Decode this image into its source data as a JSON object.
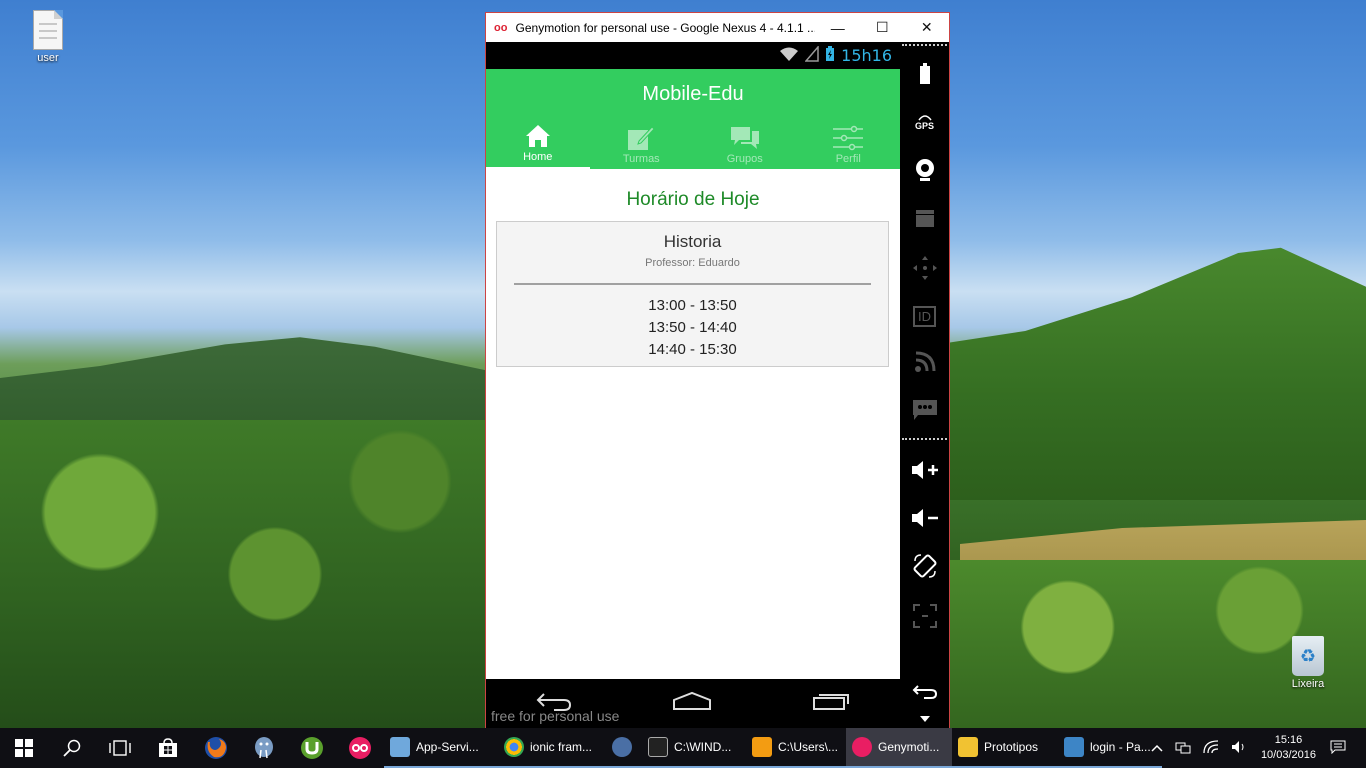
{
  "desktop": {
    "icons": [
      {
        "label": "user",
        "icon": "text-file-icon"
      },
      {
        "label": "Lixeira",
        "icon": "recycle-bin-icon"
      }
    ]
  },
  "window": {
    "title": "Genymotion for personal use - Google Nexus 4 - 4.1.1 ...",
    "controls": {
      "minimize": "—",
      "maximize": "☐",
      "close": "✕"
    }
  },
  "device": {
    "status": {
      "time": "15h16",
      "wifi": "wifi-icon",
      "signal": "signal-icon",
      "battery": "battery-charging-icon"
    },
    "app": {
      "title": "Mobile-Edu",
      "tabs": [
        {
          "label": "Home",
          "icon": "home-icon",
          "active": true
        },
        {
          "label": "Turmas",
          "icon": "edit-icon",
          "active": false
        },
        {
          "label": "Grupos",
          "icon": "chat-icon",
          "active": false
        },
        {
          "label": "Perfil",
          "icon": "sliders-icon",
          "active": false
        }
      ],
      "heading": "Horário de Hoje",
      "schedule": {
        "subject": "Historia",
        "teacher": "Professor: Eduardo",
        "times": [
          "13:00 - 13:50",
          "13:50 - 14:40",
          "14:40 - 15:30"
        ]
      }
    },
    "navbar": [
      "back-icon",
      "home-icon",
      "recent-apps-icon"
    ],
    "watermark": "free for personal use"
  },
  "sidebar": [
    "battery-icon",
    "gps-icon",
    "webcam-icon",
    "camera-icon",
    "dpad-icon",
    "id-icon",
    "rss-icon",
    "sms-icon",
    "volume-up-icon",
    "volume-down-icon",
    "rotate-icon",
    "scale-icon",
    "back-icon",
    "scroll-down-icon"
  ],
  "sidebar_labels": {
    "gps": "GPS",
    "id": "ID"
  },
  "taskbar": {
    "pinned": [
      "start-icon",
      "search-icon",
      "task-view-icon",
      "store-icon",
      "firefox-icon",
      "postgres-icon",
      "utorrent-icon",
      "genymotion-icon"
    ],
    "apps": [
      {
        "label": "App-Servi...",
        "color": "#6fa8dc"
      },
      {
        "label": "ionic fram...",
        "color": "#e8453c"
      },
      {
        "label": "",
        "color": "#4a6fa5"
      },
      {
        "label": "C:\\WIND...",
        "color": "#222222"
      },
      {
        "label": "C:\\Users\\...",
        "color": "#f39c12"
      },
      {
        "label": "Genymoti...",
        "color": "#e91e63",
        "active": true
      },
      {
        "label": "Prototipos",
        "color": "#f1c232"
      },
      {
        "label": "login - Pa...",
        "color": "#3d85c6"
      }
    ],
    "clock": {
      "time": "15:16",
      "date": "10/03/2016"
    }
  }
}
